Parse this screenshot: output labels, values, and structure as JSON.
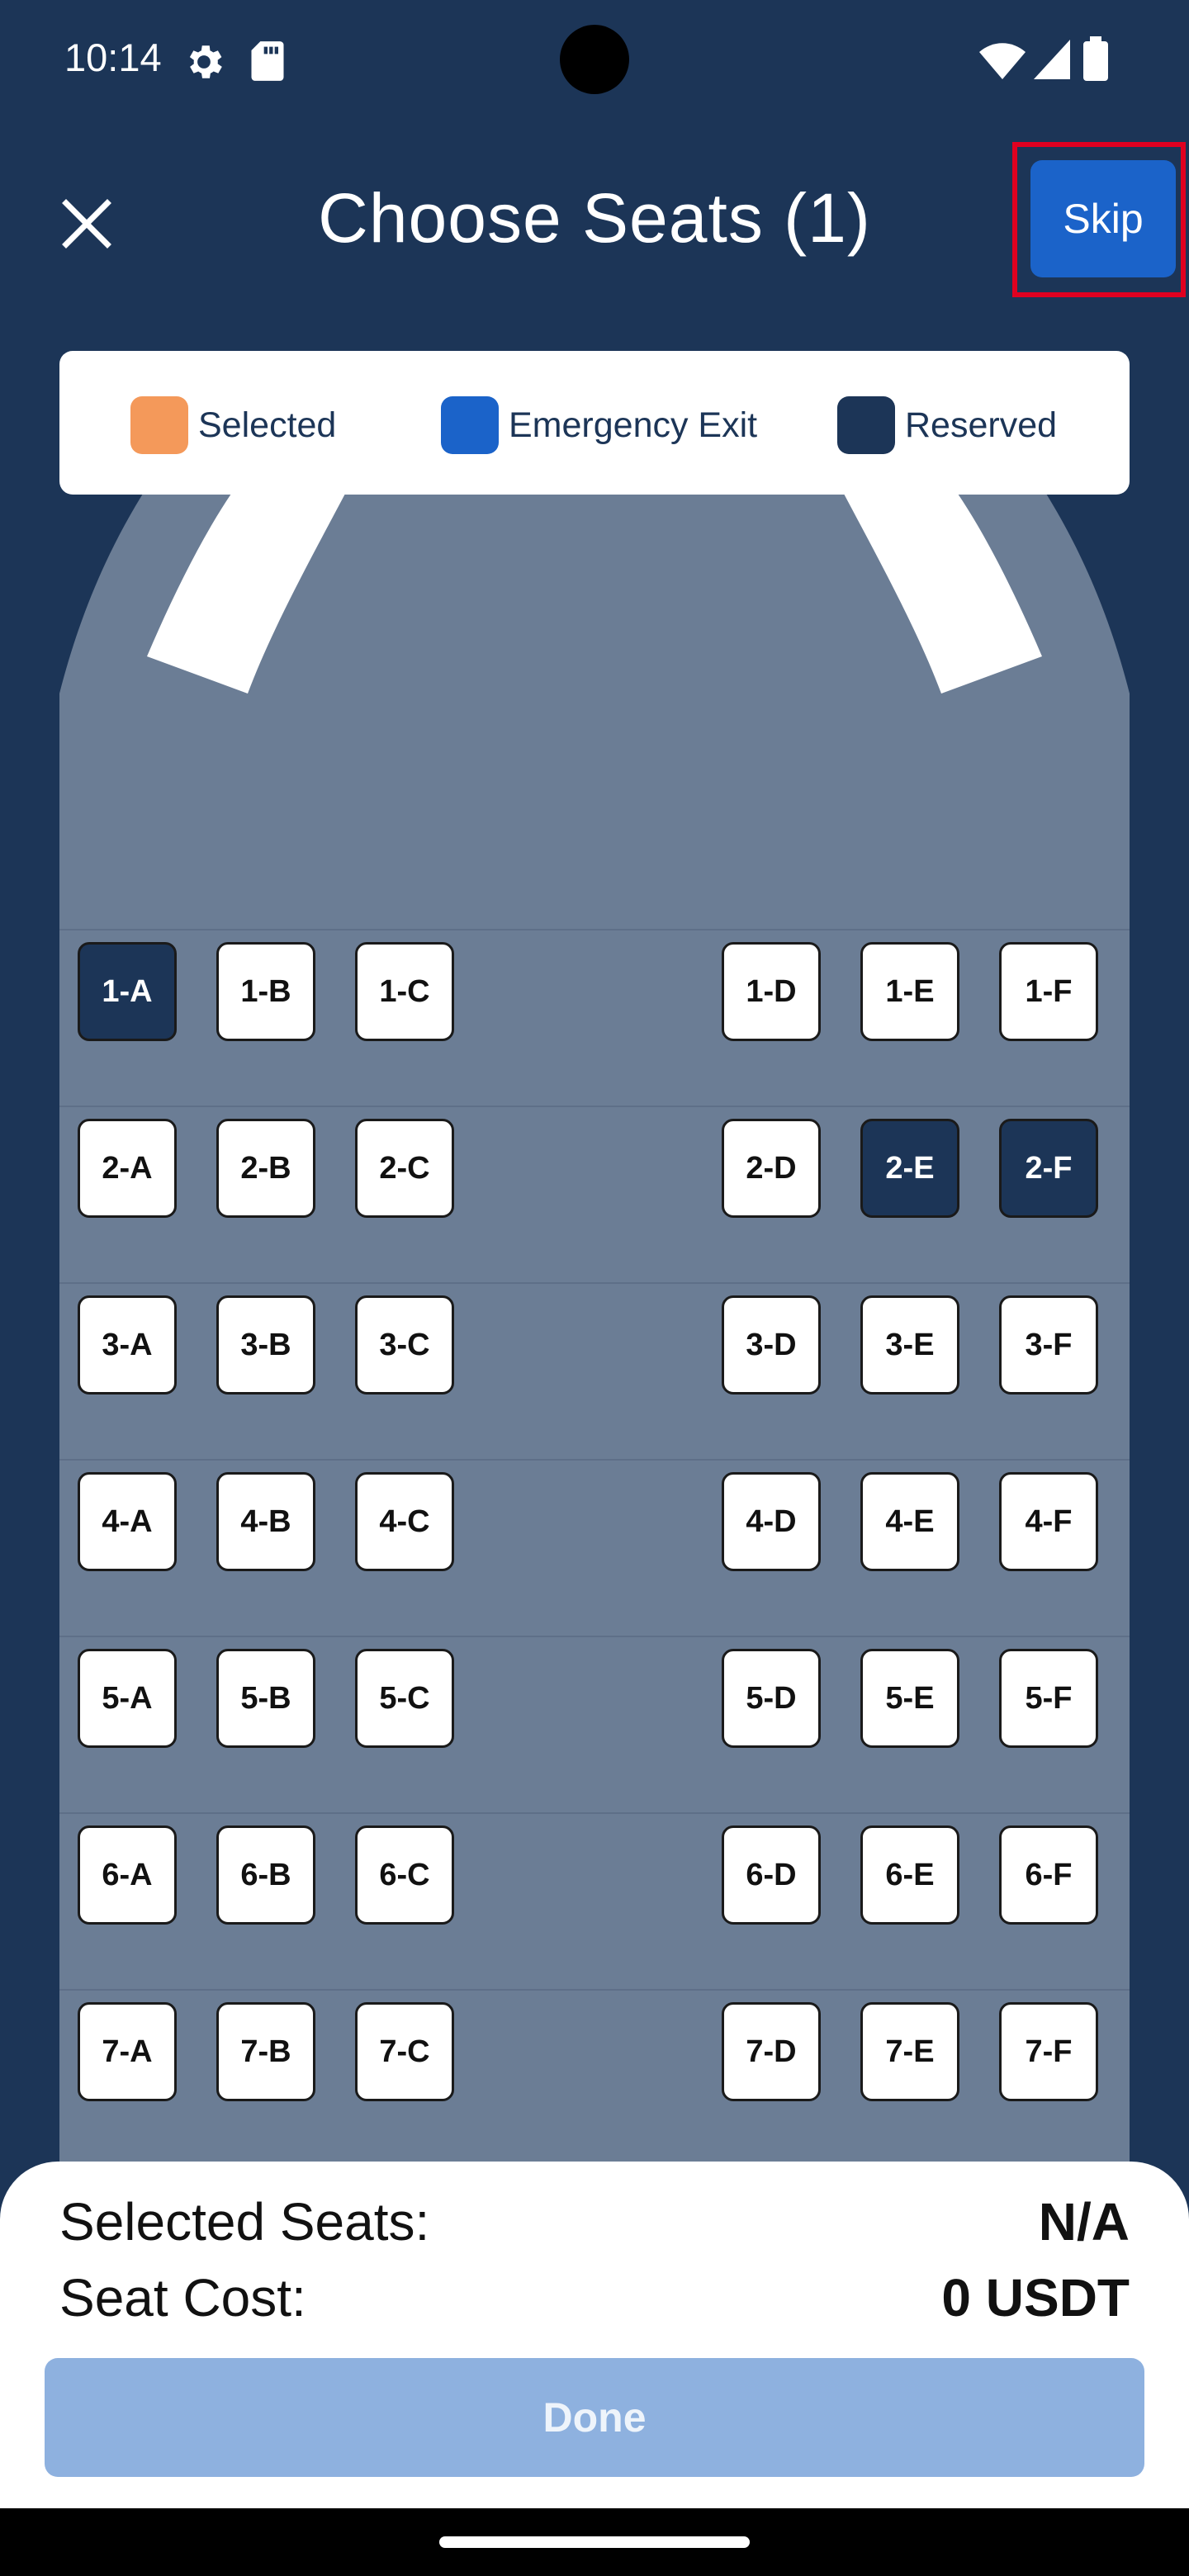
{
  "status_bar": {
    "time": "10:14",
    "icons": [
      "settings-gear-icon",
      "sd-card-icon",
      "wifi-icon",
      "cellular-signal-icon",
      "battery-icon"
    ]
  },
  "header": {
    "title": "Choose Seats (1)",
    "close_icon": "close-icon",
    "skip_label": "Skip"
  },
  "legend": [
    {
      "label": "Selected",
      "color": "#f4995a"
    },
    {
      "label": "Emergency Exit",
      "color": "#1b63c9"
    },
    {
      "label": "Reserved",
      "color": "#1c3557"
    }
  ],
  "seat_map": {
    "rows": [
      {
        "row": "1",
        "seats": [
          {
            "label": "1-A",
            "status": "reserved"
          },
          {
            "label": "1-B",
            "status": "available"
          },
          {
            "label": "1-C",
            "status": "available"
          },
          {
            "label": "1-D",
            "status": "available"
          },
          {
            "label": "1-E",
            "status": "available"
          },
          {
            "label": "1-F",
            "status": "available"
          }
        ]
      },
      {
        "row": "2",
        "seats": [
          {
            "label": "2-A",
            "status": "available"
          },
          {
            "label": "2-B",
            "status": "available"
          },
          {
            "label": "2-C",
            "status": "available"
          },
          {
            "label": "2-D",
            "status": "available"
          },
          {
            "label": "2-E",
            "status": "reserved"
          },
          {
            "label": "2-F",
            "status": "reserved"
          }
        ]
      },
      {
        "row": "3",
        "seats": [
          {
            "label": "3-A",
            "status": "available"
          },
          {
            "label": "3-B",
            "status": "available"
          },
          {
            "label": "3-C",
            "status": "available"
          },
          {
            "label": "3-D",
            "status": "available"
          },
          {
            "label": "3-E",
            "status": "available"
          },
          {
            "label": "3-F",
            "status": "available"
          }
        ]
      },
      {
        "row": "4",
        "seats": [
          {
            "label": "4-A",
            "status": "available"
          },
          {
            "label": "4-B",
            "status": "available"
          },
          {
            "label": "4-C",
            "status": "available"
          },
          {
            "label": "4-D",
            "status": "available"
          },
          {
            "label": "4-E",
            "status": "available"
          },
          {
            "label": "4-F",
            "status": "available"
          }
        ]
      },
      {
        "row": "5",
        "seats": [
          {
            "label": "5-A",
            "status": "available"
          },
          {
            "label": "5-B",
            "status": "available"
          },
          {
            "label": "5-C",
            "status": "available"
          },
          {
            "label": "5-D",
            "status": "available"
          },
          {
            "label": "5-E",
            "status": "available"
          },
          {
            "label": "5-F",
            "status": "available"
          }
        ]
      },
      {
        "row": "6",
        "seats": [
          {
            "label": "6-A",
            "status": "available"
          },
          {
            "label": "6-B",
            "status": "available"
          },
          {
            "label": "6-C",
            "status": "available"
          },
          {
            "label": "6-D",
            "status": "available"
          },
          {
            "label": "6-E",
            "status": "available"
          },
          {
            "label": "6-F",
            "status": "available"
          }
        ]
      },
      {
        "row": "7",
        "seats": [
          {
            "label": "7-A",
            "status": "available"
          },
          {
            "label": "7-B",
            "status": "available"
          },
          {
            "label": "7-C",
            "status": "available"
          },
          {
            "label": "7-D",
            "status": "available"
          },
          {
            "label": "7-E",
            "status": "available"
          },
          {
            "label": "7-F",
            "status": "available"
          }
        ]
      }
    ]
  },
  "summary": {
    "selected_seats_label": "Selected Seats:",
    "selected_seats_value": "N/A",
    "seat_cost_label": "Seat Cost:",
    "seat_cost_value": "0 USDT",
    "done_label": "Done"
  },
  "colors": {
    "background": "#1c3557",
    "cabin": "#6b7d95",
    "accent": "#1b63c9",
    "done_disabled": "#8eb1df"
  }
}
